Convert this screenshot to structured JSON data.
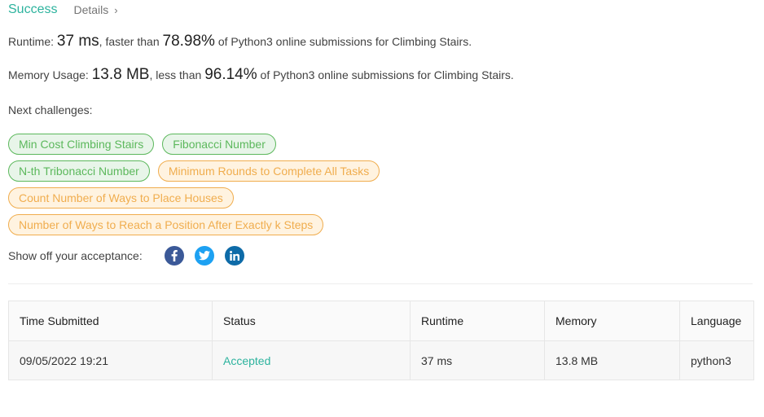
{
  "header": {
    "status": "Success",
    "details_label": "Details",
    "details_chevron": "›"
  },
  "runtime": {
    "prefix": "Runtime:",
    "value": "37 ms",
    "comparison": ", faster than",
    "percent": "78.98%",
    "suffix": "of Python3 online submissions for Climbing Stairs."
  },
  "memory": {
    "prefix": "Memory Usage:",
    "value": "13.8 MB",
    "comparison": ", less than",
    "percent": "96.14%",
    "suffix": "of Python3 online submissions for Climbing Stairs."
  },
  "next_challenges": {
    "label": "Next challenges:",
    "items": [
      {
        "label": "Min Cost Climbing Stairs",
        "difficulty": "easy"
      },
      {
        "label": "Fibonacci Number",
        "difficulty": "easy"
      },
      {
        "label": "N-th Tribonacci Number",
        "difficulty": "easy"
      },
      {
        "label": "Minimum Rounds to Complete All Tasks",
        "difficulty": "medium"
      },
      {
        "label": "Count Number of Ways to Place Houses",
        "difficulty": "medium"
      },
      {
        "label": "Number of Ways to Reach a Position After Exactly k Steps",
        "difficulty": "medium"
      }
    ]
  },
  "share": {
    "label": "Show off your acceptance:",
    "icons": [
      "facebook-icon",
      "twitter-icon",
      "linkedin-icon"
    ]
  },
  "submissions_table": {
    "headers": [
      "Time Submitted",
      "Status",
      "Runtime",
      "Memory",
      "Language"
    ],
    "rows": [
      [
        "09/05/2022 19:21",
        "Accepted",
        "37 ms",
        "13.8 MB",
        "python3"
      ]
    ]
  },
  "colors": {
    "success": "#2db39e",
    "easy": "#5cb85c",
    "medium": "#f0ad4e",
    "facebook": "#3b5998",
    "twitter": "#1da1f2",
    "linkedin": "#0e6ba8"
  }
}
